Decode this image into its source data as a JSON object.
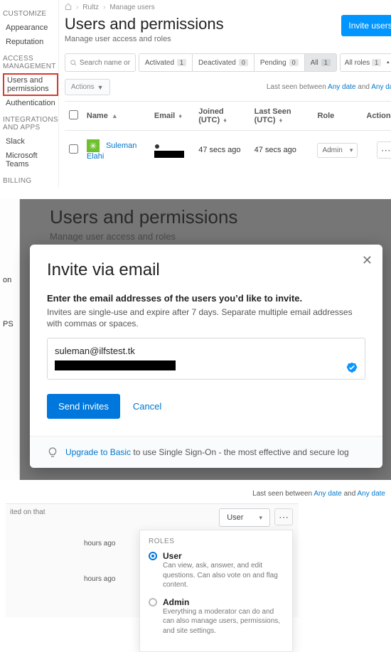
{
  "sidebar": {
    "customize": {
      "head": "CUSTOMIZE",
      "items": [
        "Appearance",
        "Reputation"
      ]
    },
    "access": {
      "head": "ACCESS MANAGEMENT",
      "items": [
        "Users and permissions",
        "Authentication"
      ],
      "activeIndex": 0
    },
    "integrations": {
      "head": "INTEGRATIONS AND APPS",
      "items": [
        "Slack",
        "Microsoft Teams"
      ]
    },
    "billing": {
      "head": "BILLING",
      "items": []
    }
  },
  "breadcrumbs": {
    "org": "Rultz",
    "page": "Manage users"
  },
  "header": {
    "title": "Users and permissions",
    "subtitle": "Manage user access and roles",
    "invite": "Invite users"
  },
  "search": {
    "placeholder": "Search name or email"
  },
  "filters": {
    "activated": {
      "label": "Activated",
      "count": "1"
    },
    "deactivated": {
      "label": "Deactivated",
      "count": "0"
    },
    "pending": {
      "label": "Pending",
      "count": "0"
    },
    "all": {
      "label": "All",
      "count": "1"
    }
  },
  "rolesFilter": {
    "label": "All roles",
    "count": "1"
  },
  "actionsBtn": "Actions",
  "lastSeenLine": {
    "prefix": "Last seen between ",
    "a": "Any date",
    "mid": " and ",
    "b": "Any date"
  },
  "table": {
    "cols": {
      "name": "Name",
      "email": "Email",
      "joined": "Joined (UTC)",
      "lastSeen": "Last Seen (UTC)",
      "role": "Role",
      "actions": "Actions"
    },
    "row": {
      "name": "Suleman Elahi",
      "joined": "47 secs ago",
      "lastSeen": "47 secs ago",
      "role": "Admin"
    }
  },
  "stage2bg": {
    "title": "Users and permissions",
    "subtitle": "Manage user access and roles"
  },
  "modal": {
    "title": "Invite via email",
    "bold": "Enter the email addresses of the users you’d like to invite.",
    "desc": "Invites are single-use and expire after 7 days. Separate multiple email addresses with commas or spaces.",
    "email": "suleman@ilfstest.tk",
    "send": "Send invites",
    "cancel": "Cancel",
    "upsell_link": "Upgrade to Basic",
    "upsell_rest": " to use Single Sign-On - the most effective and secure log"
  },
  "seen2": {
    "prefix": "Last seen between ",
    "a": "Any date",
    "mid": " and ",
    "b": "Any date"
  },
  "stage3": {
    "tinylabel": "ited on that",
    "ago": "hours ago",
    "userLabel": "User",
    "rolesHead": "ROLES",
    "user": {
      "title": "User",
      "sub": "Can view, ask, answer, and edit questions. Can also vote on and flag content."
    },
    "admin": {
      "title": "Admin",
      "sub": "Everything a moderator can do and can also manage users, permissions, and site settings."
    }
  }
}
